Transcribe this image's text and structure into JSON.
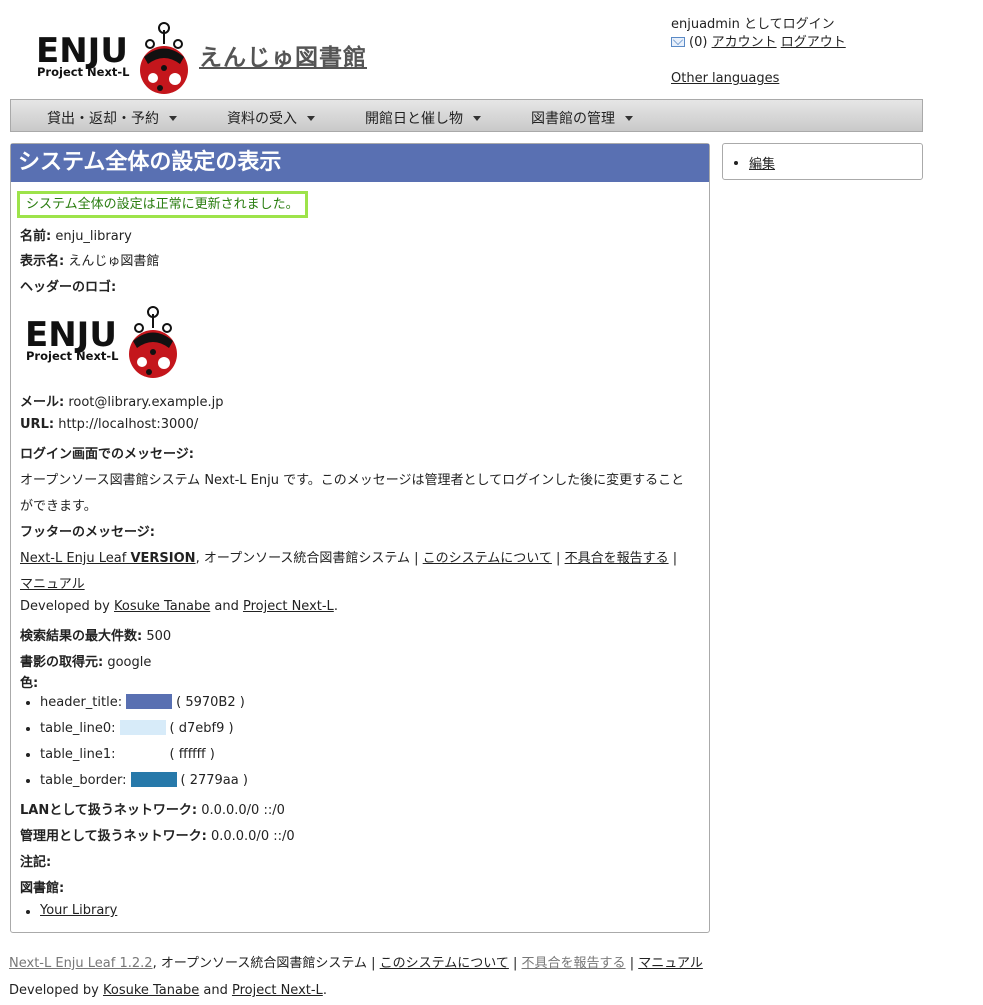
{
  "header": {
    "logo_text": "ENJU",
    "logo_sub": "Project Next-L",
    "site_title": "えんじゅ図書館",
    "user": {
      "login_status": "enjuadmin としてログイン",
      "mail_count": "(0)",
      "account_link": "アカウント",
      "logout_link": "ログアウト",
      "other_languages": "Other languages"
    }
  },
  "nav": {
    "items": [
      {
        "label": "貸出・返却・予約"
      },
      {
        "label": "資料の受入"
      },
      {
        "label": "開館日と催し物"
      },
      {
        "label": "図書館の管理"
      }
    ]
  },
  "main": {
    "title": "システム全体の設定の表示",
    "notice": "システム全体の設定は正常に更新されました。",
    "name_label": "名前:",
    "name_value": "enju_library",
    "display_name_label": "表示名:",
    "display_name_value": "えんじゅ図書館",
    "header_logo_label": "ヘッダーのロゴ:",
    "email_label": "メール:",
    "email_value": "root@library.example.jp",
    "url_label": "URL:",
    "url_value": "http://localhost:3000/",
    "login_message_label": "ログイン画面でのメッセージ:",
    "login_message_line1": "オープンソース図書館システム Next-L Enju です。このメッセージは管理者としてログインした後に変更すること",
    "login_message_line2": "ができます。",
    "footer_message_label": "フッターのメッセージ:",
    "footer_msg": {
      "link1_prefix": "Next-L Enju Leaf ",
      "link1_bold": "VERSION",
      "text1": ", オープンソース統合図書館システム | ",
      "link2": "このシステムについて",
      "sep1": " | ",
      "link3": "不具合を報告する",
      "sep2": " |",
      "link4": "マニュアル",
      "dev_prefix": "Developed by ",
      "dev_link1": "Kosuke Tanabe",
      "dev_and": " and ",
      "dev_link2": "Project Next-L",
      "dev_end": "."
    },
    "max_results_label": "検索結果の最大件数:",
    "max_results_value": "500",
    "book_jacket_label": "書影の取得元:",
    "book_jacket_value": "google",
    "colors_label": "色:",
    "colors": [
      {
        "name": "header_title:",
        "hex": "#5970B2",
        "code": "( 5970B2 )"
      },
      {
        "name": "table_line0:",
        "hex": "#d7ebf9",
        "code": "( d7ebf9 )"
      },
      {
        "name": "table_line1:",
        "hex": "#ffffff",
        "code": "( ffffff )"
      },
      {
        "name": "table_border:",
        "hex": "#2779aa",
        "code": "( 2779aa )"
      }
    ],
    "lan_label": "LANとして扱うネットワーク:",
    "lan_value": "0.0.0.0/0 ::/0",
    "admin_net_label": "管理用として扱うネットワーク:",
    "admin_net_value": "0.0.0.0/0 ::/0",
    "note_label": "注記:",
    "library_label": "図書館:",
    "library_link": "Your Library"
  },
  "side": {
    "edit_link": "編集"
  },
  "footer": {
    "link1": "Next-L Enju Leaf 1.2.2",
    "text1": ", オープンソース統合図書館システム | ",
    "link2": "このシステムについて",
    "sep1": " | ",
    "link3": "不具合を報告する",
    "sep2": " | ",
    "link4": "マニュアル",
    "dev_prefix": "Developed by ",
    "dev_link1": "Kosuke Tanabe",
    "dev_and": " and ",
    "dev_link2": "Project Next-L",
    "dev_end": "."
  }
}
